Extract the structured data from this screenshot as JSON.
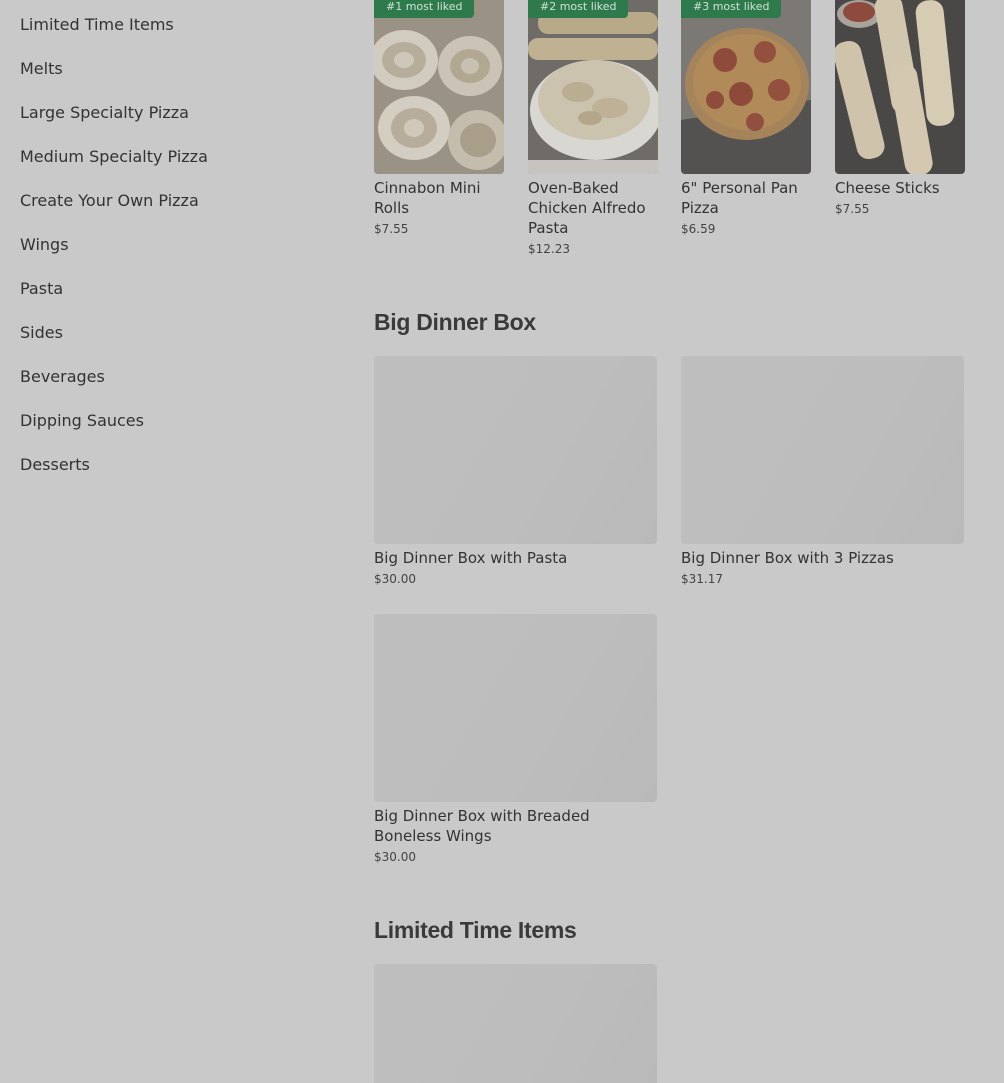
{
  "sidebar": {
    "items": [
      {
        "label": "Limited Time Items"
      },
      {
        "label": "Melts"
      },
      {
        "label": "Large Specialty Pizza"
      },
      {
        "label": "Medium Specialty Pizza"
      },
      {
        "label": "Create Your Own Pizza"
      },
      {
        "label": "Wings"
      },
      {
        "label": "Pasta"
      },
      {
        "label": "Sides"
      },
      {
        "label": "Beverages"
      },
      {
        "label": "Dipping Sauces"
      },
      {
        "label": "Desserts"
      }
    ]
  },
  "most_liked": [
    {
      "badge": "#1 most liked",
      "title": "Cinnabon Mini Rolls",
      "price": "$7.55"
    },
    {
      "badge": "#2 most liked",
      "title": "Oven-Baked Chicken Alfredo Pasta",
      "price": "$12.23"
    },
    {
      "badge": "#3 most liked",
      "title": "6\" Personal Pan Pizza",
      "price": "$6.59"
    },
    {
      "badge": "",
      "title": "Cheese Sticks",
      "price": "$7.55"
    }
  ],
  "big_dinner_box": {
    "title": "Big Dinner Box",
    "items": [
      {
        "title": "Big Dinner Box with Pasta",
        "price": "$30.00"
      },
      {
        "title": "Big Dinner Box with 3 Pizzas",
        "price": "$31.17"
      },
      {
        "title": "Big Dinner Box with Breaded Boneless Wings",
        "price": "$30.00"
      }
    ]
  },
  "limited_time": {
    "title": "Limited Time Items"
  },
  "colors": {
    "badge_bg": "#2f7a4c",
    "overlay_bg": "#c9c9c9",
    "text": "#333333"
  }
}
